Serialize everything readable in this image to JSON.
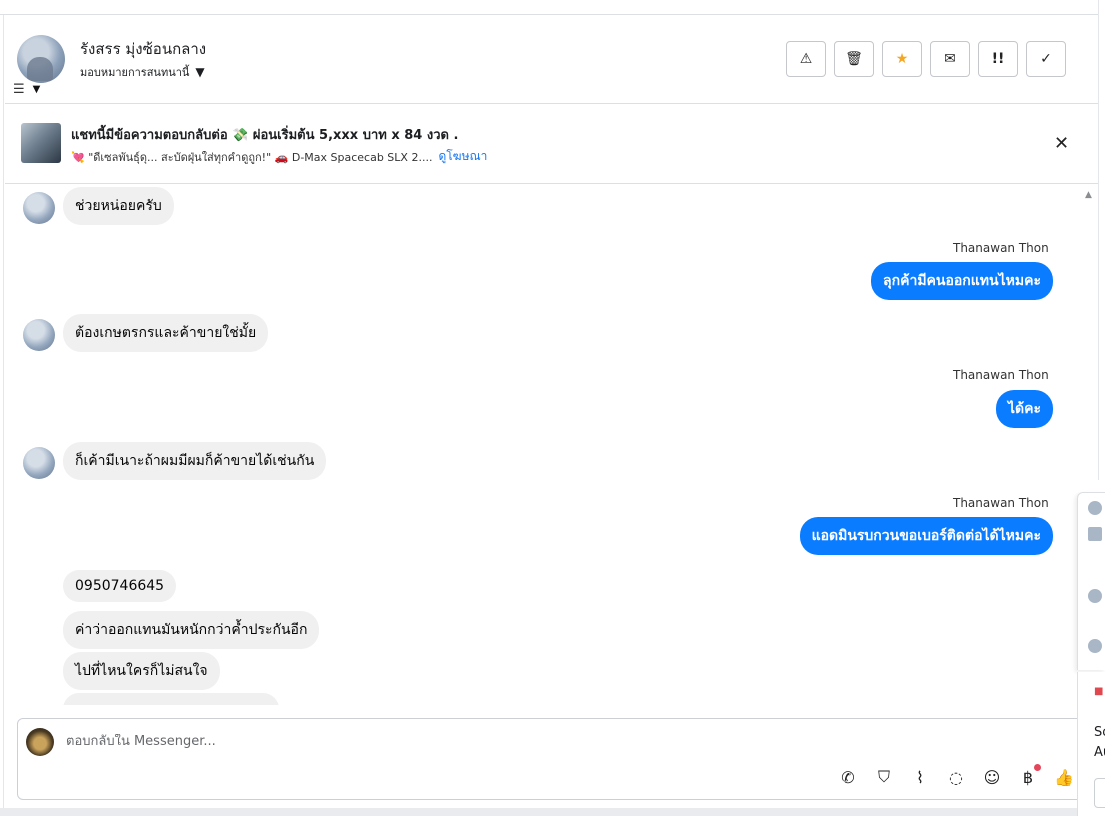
{
  "header": {
    "contact_name": "รังสรร มุ่งซ้อนกลาง",
    "assign_label": "มอบหมายการสนทนานี้",
    "actions": [
      {
        "name": "warning-button",
        "icon": "warning-icon",
        "glyph": "⚠"
      },
      {
        "name": "delete-button",
        "icon": "trash-icon",
        "glyph": "🗑"
      },
      {
        "name": "star-button",
        "icon": "star-icon",
        "glyph": "★"
      },
      {
        "name": "mark-unread-button",
        "icon": "envelope-icon",
        "glyph": "✉"
      },
      {
        "name": "follow-up-button",
        "icon": "priority-icon",
        "glyph": "!!"
      },
      {
        "name": "mark-done-button",
        "icon": "check-icon",
        "glyph": "✓"
      }
    ]
  },
  "ad": {
    "title": "แชทนี้มีข้อความตอบกลับต่อ 💸 ผ่อนเริ่มต้น 5,xxx บาท x 84 งวด .",
    "subtitle": "💘 \"ดีเซลพันธุ์ดุ... สะบัดฝุ่นใส่ทุกคำดูถูก!\" 🚗 D-Max Spacecab SLX 2....",
    "link": "ดูโฆษณา"
  },
  "messages": [
    {
      "dir": "in",
      "text": "ช่วยหน่อยครับ"
    },
    {
      "dir": "out",
      "sender": "Thanawan Thon",
      "text": "ลุกค้ามีคนออกแทนไหมคะ"
    },
    {
      "dir": "in",
      "text": "ต้องเกษตรกรและค้าขายใช่มั้ย"
    },
    {
      "dir": "out",
      "sender": "Thanawan Thon",
      "text": "ได้คะ"
    },
    {
      "dir": "in",
      "text": "ก็เค้ามีเนาะถ้าผมมีผมก็ค้าขายได้เช่นกัน"
    },
    {
      "dir": "out",
      "sender": "Thanawan Thon",
      "text": "แอดมินรบกวนขอเบอร์ติดต่อได้ไหมคะ"
    },
    {
      "dir": "in",
      "text": "0950746645"
    },
    {
      "dir": "in",
      "text": "ค่าว่าออกแทนมันหนักกว่าค้ำประกันอีก"
    },
    {
      "dir": "in",
      "text": "ไปที่ไหนใครก็ไม่สนใจ"
    }
  ],
  "composer": {
    "placeholder": "ตอบกลับใน Messenger...",
    "tools": [
      {
        "name": "call-icon",
        "glyph": "📞"
      },
      {
        "name": "shopping-bag-icon",
        "glyph": "👜"
      },
      {
        "name": "attachment-icon",
        "glyph": "📎"
      },
      {
        "name": "chat-bubble-icon",
        "glyph": "💬"
      },
      {
        "name": "emoji-icon",
        "glyph": "☺"
      },
      {
        "name": "baht-icon",
        "glyph": "฿"
      },
      {
        "name": "thumbs-up-icon",
        "glyph": "👍"
      }
    ]
  },
  "side_panel": {
    "text_line1": "So",
    "text_line2": "Au"
  }
}
